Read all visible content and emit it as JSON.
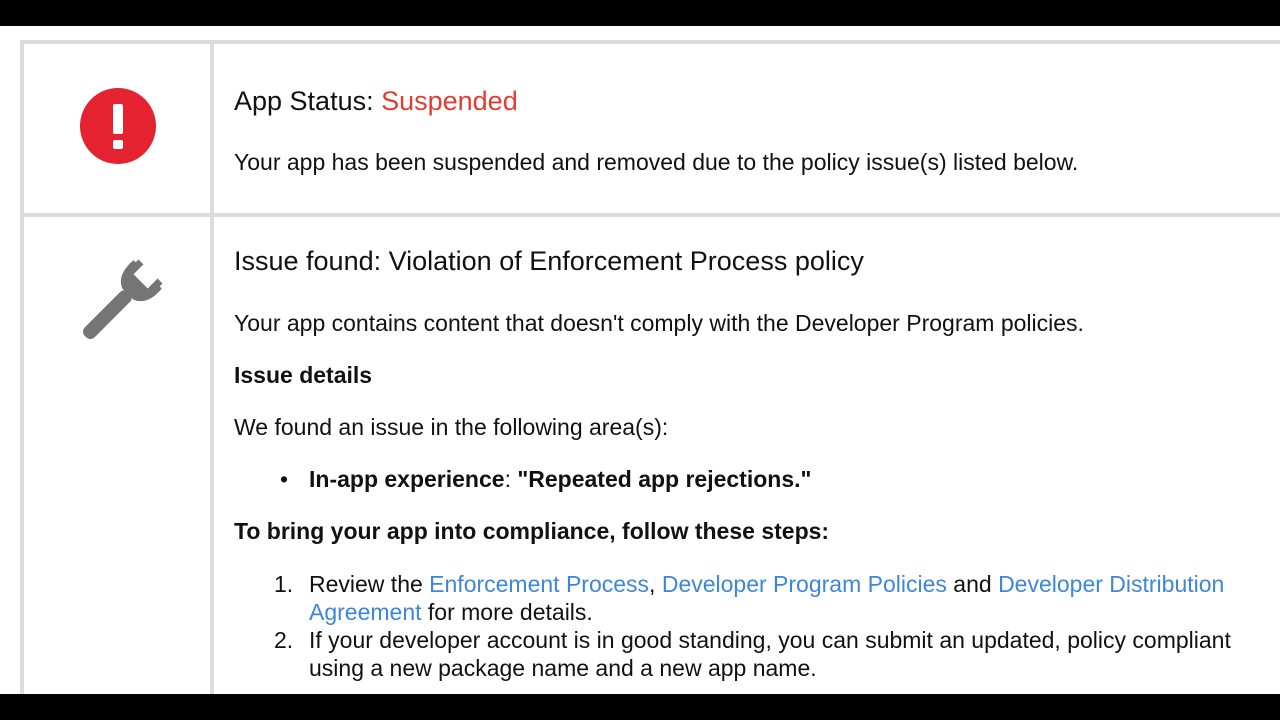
{
  "status": {
    "label": "App Status: ",
    "value": "Suspended",
    "description": "Your app has been suspended and removed due to the policy issue(s) listed below.",
    "value_color": "#e53b30"
  },
  "issue": {
    "title": "Issue found: Violation of Enforcement Process policy",
    "description": "Your app contains content that doesn't comply with the Developer Program policies.",
    "details_heading": "Issue details",
    "area_intro": "We found an issue in the following area(s):",
    "bullet": {
      "label": "In-app experience",
      "separator": ": ",
      "quote": "\"Repeated app rejections.\""
    }
  },
  "compliance": {
    "heading": "To bring your app into compliance, follow these steps:",
    "steps": [
      {
        "number": "1.",
        "prefix": "Review the ",
        "link1": "Enforcement Process",
        "sep1": ", ",
        "link2": "Developer Program Policies",
        "sep2": " and ",
        "link3a": "Developer Distribution",
        "link3b": "Agreement",
        "suffix": " for more details."
      },
      {
        "number": "2.",
        "line1": "If your developer account is in good standing, you can submit an updated, policy compliant",
        "line2": "using a new package name and a new app name."
      }
    ]
  },
  "icons": {
    "status": "alert-circle-icon",
    "issue": "wrench-icon"
  },
  "colors": {
    "alert_red": "#e53b30",
    "link_blue": "#3e86d8",
    "border_gray": "#dcdcdc",
    "icon_gray": "#757575"
  }
}
